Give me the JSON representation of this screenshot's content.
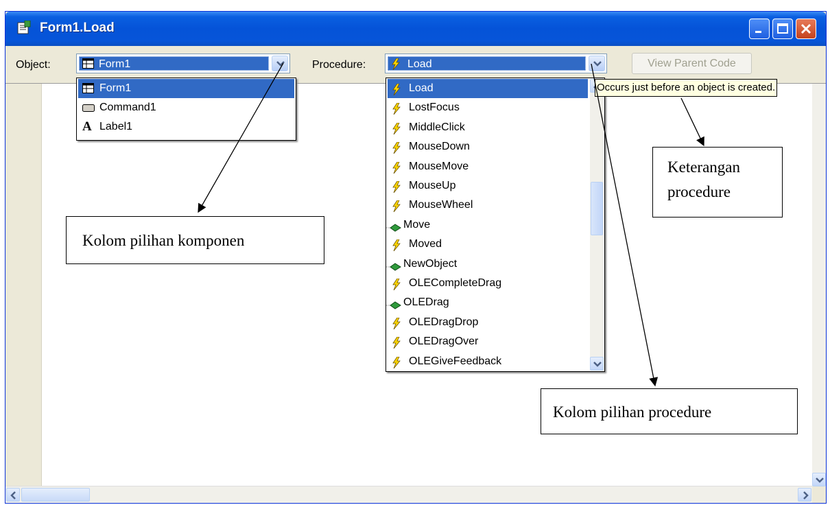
{
  "window": {
    "title": "Form1.Load",
    "controls": [
      "minimize",
      "maximize",
      "close"
    ]
  },
  "toolbar": {
    "object_label": "Object:",
    "object_value": "Form1",
    "procedure_label": "Procedure:",
    "procedure_value": "Load",
    "view_parent_button": "View Parent Code"
  },
  "object_dropdown": {
    "items": [
      {
        "label": "Form1",
        "icon": "form-icon",
        "selected": true
      },
      {
        "label": "Command1",
        "icon": "command-button-icon",
        "selected": false
      },
      {
        "label": "Label1",
        "icon": "label-icon",
        "selected": false
      }
    ]
  },
  "procedure_dropdown": {
    "items": [
      {
        "label": "Load",
        "icon": "event-icon",
        "selected": true
      },
      {
        "label": "LostFocus",
        "icon": "event-icon"
      },
      {
        "label": "MiddleClick",
        "icon": "event-icon"
      },
      {
        "label": "MouseDown",
        "icon": "event-icon"
      },
      {
        "label": "MouseMove",
        "icon": "event-icon"
      },
      {
        "label": "MouseUp",
        "icon": "event-icon"
      },
      {
        "label": "MouseWheel",
        "icon": "event-icon"
      },
      {
        "label": "Move",
        "icon": "method-icon"
      },
      {
        "label": "Moved",
        "icon": "event-icon"
      },
      {
        "label": "NewObject",
        "icon": "method-icon"
      },
      {
        "label": "OLECompleteDrag",
        "icon": "event-icon"
      },
      {
        "label": "OLEDrag",
        "icon": "method-icon"
      },
      {
        "label": "OLEDragDrop",
        "icon": "event-icon"
      },
      {
        "label": "OLEDragOver",
        "icon": "event-icon"
      },
      {
        "label": "OLEGiveFeedback",
        "icon": "event-icon"
      }
    ]
  },
  "tooltip": "Occurs just before an object is created.",
  "callouts": {
    "object": "Kolom pilihan komponen",
    "description_line1": "Keterangan",
    "description_line2": "procedure",
    "procedure": "Kolom pilihan procedure"
  },
  "colors": {
    "title_bar": "#0553d8",
    "selection": "#316ac5",
    "tooltip_bg": "#ffffe1",
    "window_face": "#ece9d8"
  }
}
